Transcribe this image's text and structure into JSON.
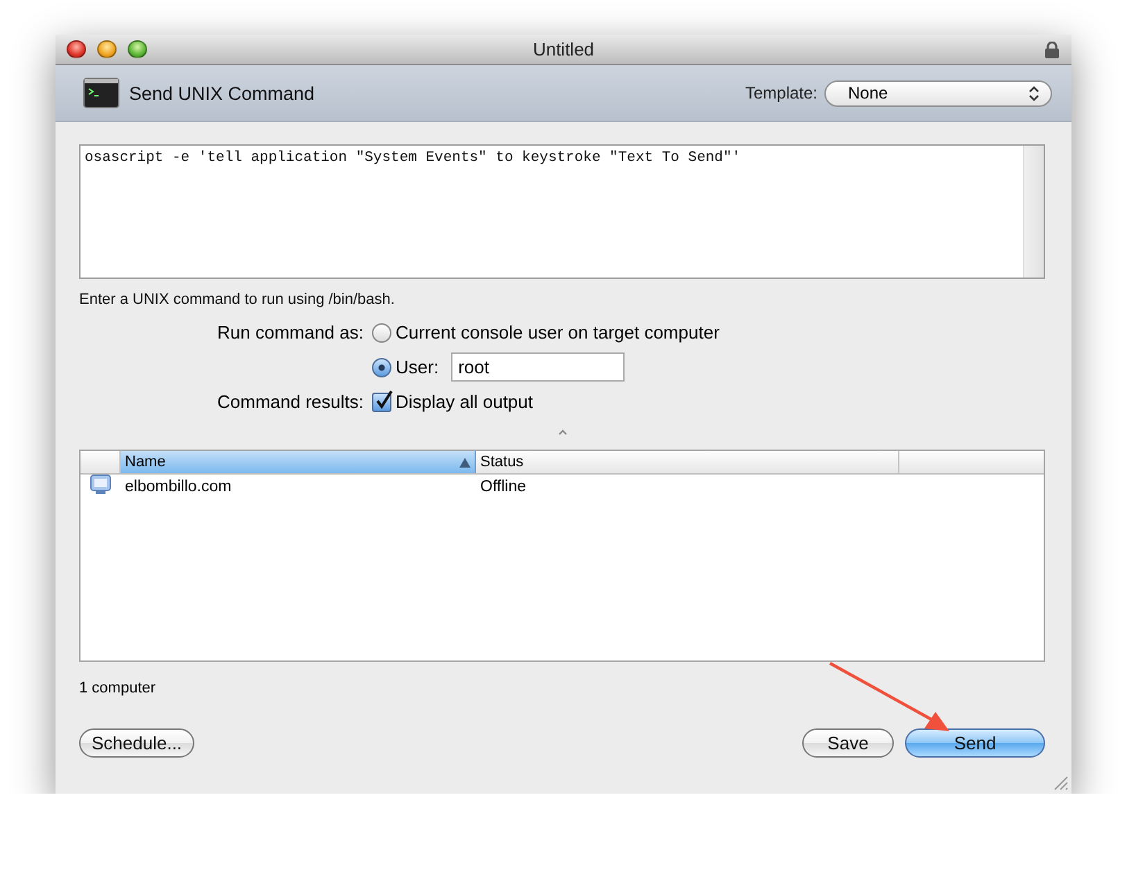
{
  "window": {
    "title": "Untitled",
    "locked": true
  },
  "header": {
    "title": "Send UNIX Command",
    "template_label": "Template:",
    "template_value": "None"
  },
  "command": {
    "value": "osascript -e 'tell application \"System Events\" to keystroke \"Text To Send\"'"
  },
  "hint": "Enter a UNIX command to run using /bin/bash.",
  "run_as": {
    "label": "Run command as:",
    "options": [
      {
        "label": "Current console user on target computer",
        "selected": false
      },
      {
        "label": "User:",
        "selected": true,
        "field_value": "root"
      }
    ]
  },
  "results": {
    "label": "Command results:",
    "checkbox": {
      "label": "Display all output",
      "checked": true
    }
  },
  "table": {
    "columns": [
      {
        "label": "Name",
        "sorted": true
      },
      {
        "label": "Status",
        "sorted": false
      }
    ],
    "rows": [
      {
        "name": "elbombillo.com",
        "status": "Offline"
      }
    ]
  },
  "count": "1 computer",
  "buttons": [
    {
      "label": "Schedule...",
      "default": false
    },
    {
      "label": "Save",
      "default": false
    },
    {
      "label": "Send",
      "default": true
    }
  ]
}
